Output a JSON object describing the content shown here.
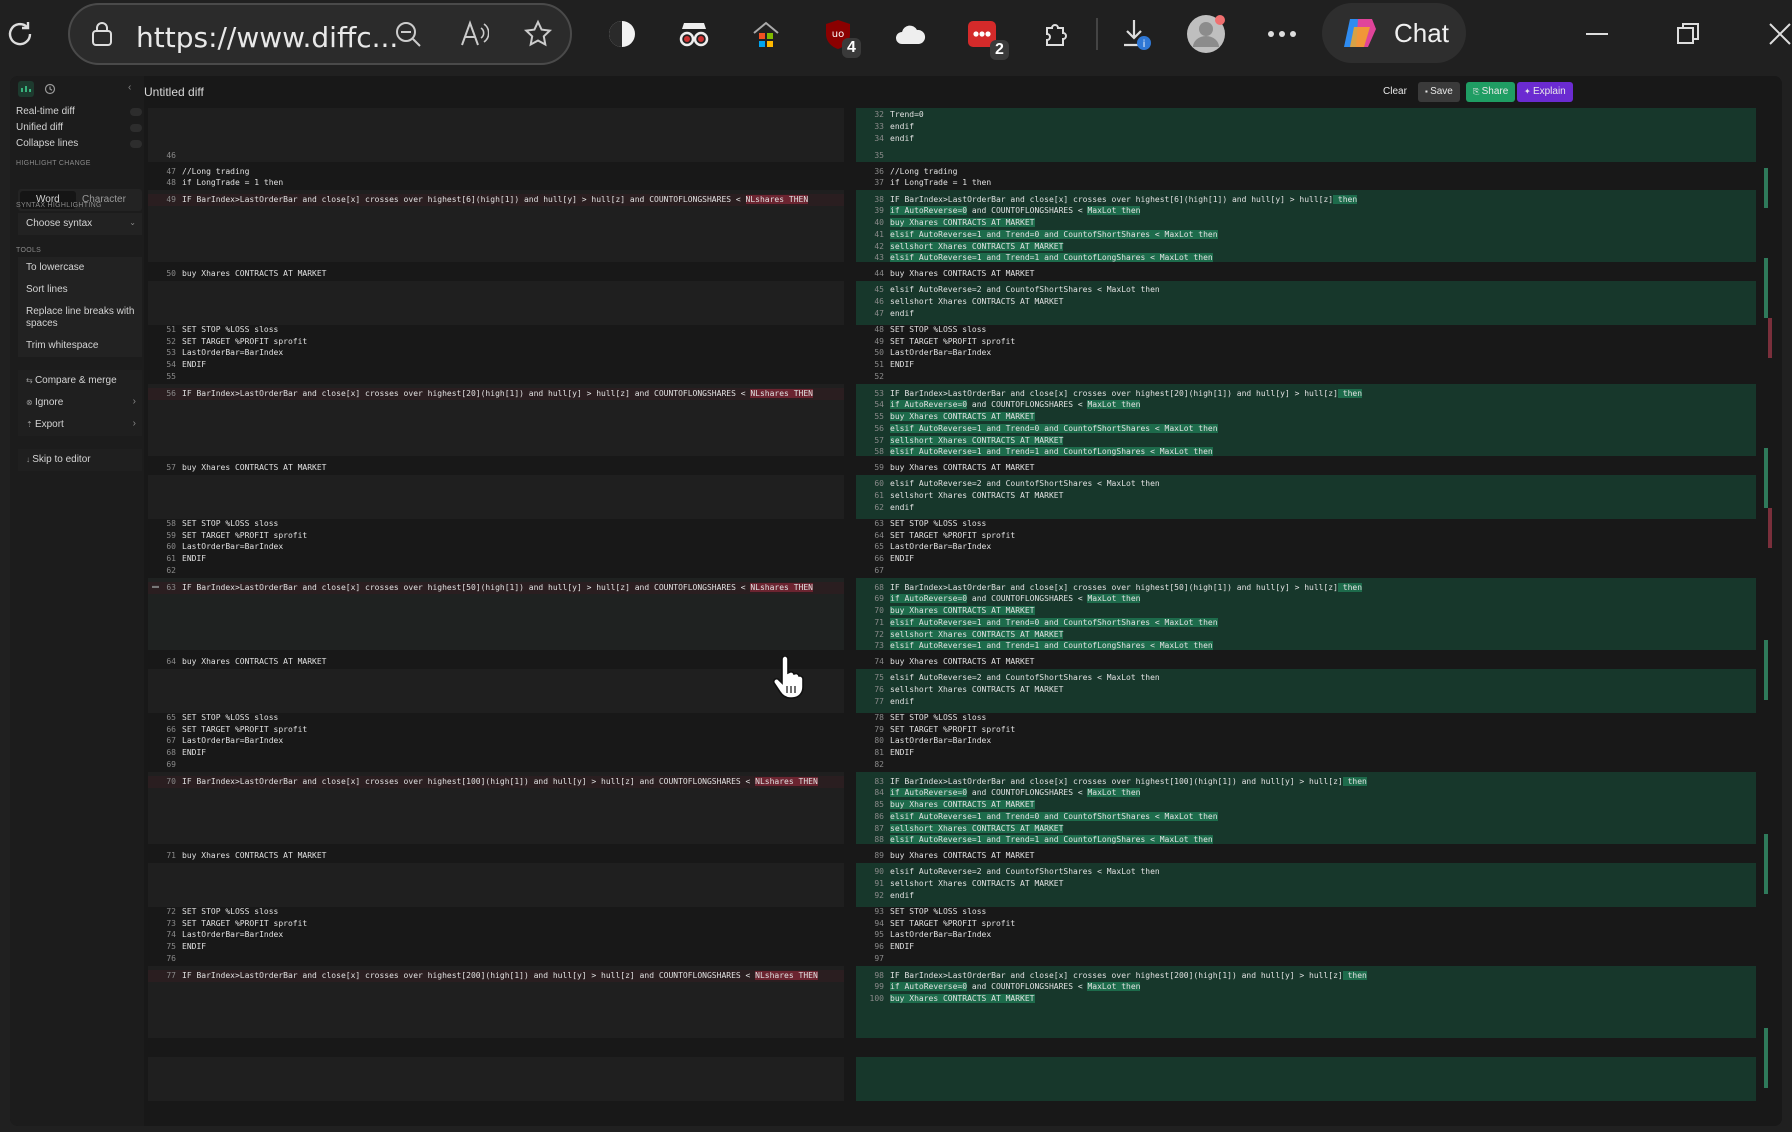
{
  "browser": {
    "url": "https://www.diffc...",
    "badges": {
      "ublock": "4",
      "ext_dots": "2"
    },
    "chat_label": "Chat",
    "colors": {
      "frame": "#202020",
      "address_bg": "#2b2b2b"
    }
  },
  "app": {
    "title": "Untitled diff",
    "header_buttons": {
      "clear": "Clear",
      "save": "Save",
      "share": "Share",
      "explain": "Explain"
    },
    "colors": {
      "share": "#1f9d63",
      "explain": "#6b2bd1",
      "added_bg": "#17372b",
      "added_word": "#1d6b4b",
      "removed_word": "#6b2430"
    }
  },
  "sidebar": {
    "options": [
      "Real-time diff",
      "Unified diff",
      "Collapse lines"
    ],
    "highlight_heading": "HIGHLIGHT CHANGE",
    "highlight_modes": [
      "Word",
      "Character"
    ],
    "syntax_heading": "SYNTAX HIGHLIGHTING",
    "syntax_select": "Choose syntax",
    "tools_heading": "TOOLS",
    "tools": [
      "To lowercase",
      "Sort lines",
      "Replace line breaks with spaces",
      "Trim whitespace"
    ],
    "actions": [
      "Compare & merge",
      "Ignore",
      "Export"
    ],
    "skip": "Skip to editor"
  },
  "diff": {
    "left": [
      {
        "n": "46",
        "t": ""
      },
      {
        "n": "47",
        "t": "//Long trading"
      },
      {
        "n": "48",
        "t": "if LongTrade = 1 then"
      },
      {
        "n": "49",
        "t": "IF BarIndex>LastOrderBar and close[x] crosses over highest[6](high[1]) and hull[y] > hull[z] and COUNTOFLONGSHARES < ",
        "h": "NLshares THEN"
      },
      {
        "n": "50",
        "t": "buy Xhares CONTRACTS AT MARKET"
      },
      {
        "n": "51",
        "t": "SET STOP %LOSS sloss"
      },
      {
        "n": "52",
        "t": "SET TARGET %PROFIT sprofit"
      },
      {
        "n": "53",
        "t": "LastOrderBar=BarIndex"
      },
      {
        "n": "54",
        "t": "ENDIF"
      },
      {
        "n": "55",
        "t": ""
      },
      {
        "n": "56",
        "t": "IF BarIndex>LastOrderBar and close[x] crosses over highest[20](high[1]) and hull[y] > hull[z] and COUNTOFLONGSHARES < ",
        "h": "NLshares THEN"
      },
      {
        "n": "57",
        "t": "buy Xhares CONTRACTS AT MARKET"
      },
      {
        "n": "58",
        "t": "SET STOP %LOSS sloss"
      },
      {
        "n": "59",
        "t": "SET TARGET %PROFIT sprofit"
      },
      {
        "n": "60",
        "t": "LastOrderBar=BarIndex"
      },
      {
        "n": "61",
        "t": "ENDIF"
      },
      {
        "n": "62",
        "t": ""
      },
      {
        "n": "63",
        "t": "IF BarIndex>LastOrderBar and close[x] crosses over highest[50](high[1]) and hull[y] > hull[z] and COUNTOFLONGSHARES < ",
        "h": "NLshares THEN"
      },
      {
        "n": "64",
        "t": "buy Xhares CONTRACTS AT MARKET"
      },
      {
        "n": "65",
        "t": "SET STOP %LOSS sloss"
      },
      {
        "n": "66",
        "t": "SET TARGET %PROFIT sprofit"
      },
      {
        "n": "67",
        "t": "LastOrderBar=BarIndex"
      },
      {
        "n": "68",
        "t": "ENDIF"
      },
      {
        "n": "69",
        "t": ""
      },
      {
        "n": "70",
        "t": "IF BarIndex>LastOrderBar and close[x] crosses over highest[100](high[1]) and hull[y] > hull[z] and COUNTOFLONGSHARES < ",
        "h": "NLshares THEN"
      },
      {
        "n": "71",
        "t": "buy Xhares CONTRACTS AT MARKET"
      },
      {
        "n": "72",
        "t": "SET STOP %LOSS sloss"
      },
      {
        "n": "73",
        "t": "SET TARGET %PROFIT sprofit"
      },
      {
        "n": "74",
        "t": "LastOrderBar=BarIndex"
      },
      {
        "n": "75",
        "t": "ENDIF"
      },
      {
        "n": "76",
        "t": ""
      },
      {
        "n": "77",
        "t": "IF BarIndex>LastOrderBar and close[x] crosses over highest[200](high[1]) and hull[y] > hull[z] and COUNTOFLONGSHARES < ",
        "h": "NLshares THEN"
      }
    ],
    "right": [
      {
        "n": "32",
        "t": "Trend=0",
        "a": 1
      },
      {
        "n": "33",
        "t": "endif",
        "a": 1
      },
      {
        "n": "34",
        "t": "endif",
        "a": 1
      },
      {
        "n": "35",
        "t": ""
      },
      {
        "n": "36",
        "t": "//Long trading"
      },
      {
        "n": "37",
        "t": "if LongTrade = 1 then"
      },
      {
        "n": "38",
        "t": "IF BarIndex>LastOrderBar and close[x] crosses over highest[6](high[1]) and hull[y] > hull[z]",
        "h": " then"
      },
      {
        "n": "39",
        "t": "",
        "h": "if AutoReverse=0",
        "t2": " and COUNTOFLONGSHARES < ",
        "h2": "MaxLot then"
      },
      {
        "n": "40",
        "t": "",
        "h": "buy Xhares CONTRACTS AT MARKET"
      },
      {
        "n": "41",
        "t": "",
        "h": "elsif AutoReverse=1 and Trend=0 and CountofShortShares < MaxLot then"
      },
      {
        "n": "42",
        "t": "",
        "h": "sellshort Xhares CONTRACTS AT MARKET"
      },
      {
        "n": "43",
        "t": "",
        "h": "elsif AutoReverse=1 and Trend=1 and CountofLongShares < MaxLot then"
      },
      {
        "n": "44",
        "t": "buy Xhares CONTRACTS AT MARKET"
      },
      {
        "n": "45",
        "t": "elsif AutoReverse=2 and CountofShortShares < MaxLot then"
      },
      {
        "n": "46",
        "t": "sellshort Xhares CONTRACTS AT MARKET"
      },
      {
        "n": "47",
        "t": "endif"
      },
      {
        "n": "48",
        "t": "SET STOP %LOSS sloss"
      },
      {
        "n": "49",
        "t": "SET TARGET %PROFIT sprofit"
      },
      {
        "n": "50",
        "t": "LastOrderBar=BarIndex"
      },
      {
        "n": "51",
        "t": "ENDIF"
      },
      {
        "n": "52",
        "t": ""
      },
      {
        "n": "53",
        "t": "IF BarIndex>LastOrderBar and close[x] crosses over highest[20](high[1]) and hull[y] > hull[z]",
        "h": " then"
      },
      {
        "n": "54",
        "t": "",
        "h": "if AutoReverse=0",
        "t2": " and COUNTOFLONGSHARES < ",
        "h2": "MaxLot then"
      },
      {
        "n": "55",
        "t": "",
        "h": "buy Xhares CONTRACTS AT MARKET"
      },
      {
        "n": "56",
        "t": "",
        "h": "elsif AutoReverse=1 and Trend=0 and CountofShortShares < MaxLot then"
      },
      {
        "n": "57",
        "t": "",
        "h": "sellshort Xhares CONTRACTS AT MARKET"
      },
      {
        "n": "58",
        "t": "",
        "h": "elsif AutoReverse=1 and Trend=1 and CountofLongShares < MaxLot then"
      },
      {
        "n": "59",
        "t": "buy Xhares CONTRACTS AT MARKET"
      },
      {
        "n": "60",
        "t": "elsif AutoReverse=2 and CountofShortShares < MaxLot then"
      },
      {
        "n": "61",
        "t": "sellshort Xhares CONTRACTS AT MARKET"
      },
      {
        "n": "62",
        "t": "endif"
      },
      {
        "n": "63",
        "t": "SET STOP %LOSS sloss"
      },
      {
        "n": "64",
        "t": "SET TARGET %PROFIT sprofit"
      },
      {
        "n": "65",
        "t": "LastOrderBar=BarIndex"
      },
      {
        "n": "66",
        "t": "ENDIF"
      },
      {
        "n": "67",
        "t": ""
      },
      {
        "n": "68",
        "t": "IF BarIndex>LastOrderBar and close[x] crosses over highest[50](high[1]) and hull[y] > hull[z]",
        "h": " then"
      },
      {
        "n": "69",
        "t": "",
        "h": "if AutoReverse=0",
        "t2": " and COUNTOFLONGSHARES < ",
        "h2": "MaxLot then"
      },
      {
        "n": "70",
        "t": "",
        "h": "buy Xhares CONTRACTS AT MARKET"
      },
      {
        "n": "71",
        "t": "",
        "h": "elsif AutoReverse=1 and Trend=0 and CountofShortShares < MaxLot then"
      },
      {
        "n": "72",
        "t": "",
        "h": "sellshort Xhares CONTRACTS AT MARKET"
      },
      {
        "n": "73",
        "t": "",
        "h": "elsif AutoReverse=1 and Trend=1 and CountofLongShares < MaxLot then"
      },
      {
        "n": "74",
        "t": "buy Xhares CONTRACTS AT MARKET"
      },
      {
        "n": "75",
        "t": "elsif AutoReverse=2 and CountofShortShares < MaxLot then"
      },
      {
        "n": "76",
        "t": "sellshort Xhares CONTRACTS AT MARKET"
      },
      {
        "n": "77",
        "t": "endif"
      },
      {
        "n": "78",
        "t": "SET STOP %LOSS sloss"
      },
      {
        "n": "79",
        "t": "SET TARGET %PROFIT sprofit"
      },
      {
        "n": "80",
        "t": "LastOrderBar=BarIndex"
      },
      {
        "n": "81",
        "t": "ENDIF"
      },
      {
        "n": "82",
        "t": ""
      },
      {
        "n": "83",
        "t": "IF BarIndex>LastOrderBar and close[x] crosses over highest[100](high[1]) and hull[y] > hull[z]",
        "h": " then"
      },
      {
        "n": "84",
        "t": "",
        "h": "if AutoReverse=0",
        "t2": " and COUNTOFLONGSHARES < ",
        "h2": "MaxLot then"
      },
      {
        "n": "85",
        "t": "",
        "h": "buy Xhares CONTRACTS AT MARKET"
      },
      {
        "n": "86",
        "t": "",
        "h": "elsif AutoReverse=1 and Trend=0 and CountofShortShares < MaxLot then"
      },
      {
        "n": "87",
        "t": "",
        "h": "sellshort Xhares CONTRACTS AT MARKET"
      },
      {
        "n": "88",
        "t": "",
        "h": "elsif AutoReverse=1 and Trend=1 and CountofLongShares < MaxLot then"
      },
      {
        "n": "89",
        "t": "buy Xhares CONTRACTS AT MARKET"
      },
      {
        "n": "90",
        "t": "elsif AutoReverse=2 and CountofShortShares < MaxLot then"
      },
      {
        "n": "91",
        "t": "sellshort Xhares CONTRACTS AT MARKET"
      },
      {
        "n": "92",
        "t": "endif"
      },
      {
        "n": "93",
        "t": "SET STOP %LOSS sloss"
      },
      {
        "n": "94",
        "t": "SET TARGET %PROFIT sprofit"
      },
      {
        "n": "95",
        "t": "LastOrderBar=BarIndex"
      },
      {
        "n": "96",
        "t": "ENDIF"
      },
      {
        "n": "97",
        "t": ""
      },
      {
        "n": "98",
        "t": "IF BarIndex>LastOrderBar and close[x] crosses over highest[200](high[1]) and hull[y] > hull[z]",
        "h": " then"
      },
      {
        "n": "99",
        "t": "",
        "h": "if AutoReverse=0",
        "t2": " and COUNTOFLONGSHARES < ",
        "h2": "MaxLot then"
      },
      {
        "n": "100",
        "t": "",
        "h": "buy Xhares CONTRACTS AT MARKET"
      }
    ]
  }
}
